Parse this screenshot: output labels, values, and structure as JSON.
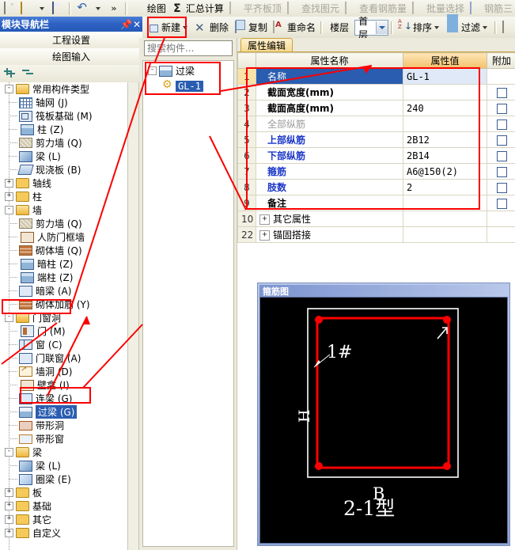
{
  "toolbar_top": {
    "items": [
      {
        "label": "",
        "icon": "new-document-icon",
        "dim": false
      },
      {
        "label": "",
        "icon": "open-folder-icon",
        "dim": false
      },
      {
        "label": "",
        "icon": "dropdown-caret-icon",
        "dim": false
      },
      {
        "label": "",
        "icon": "save-icon",
        "dim": false
      },
      {
        "label": "",
        "icon": "undo-icon",
        "dim": false
      },
      {
        "label": "",
        "icon": "dropdown-caret-icon",
        "dim": false
      },
      {
        "label": "",
        "icon": "more-chevron-icon",
        "dim": false
      },
      {
        "label": "绘图",
        "icon": "draw-pen-icon",
        "dim": false
      },
      {
        "label": "汇总计算",
        "icon": "sigma-icon",
        "dim": false
      },
      {
        "label": "平齐板顶",
        "icon": "align-slab-icon",
        "dim": true
      },
      {
        "label": "查找图元",
        "icon": "find-element-icon",
        "dim": true
      },
      {
        "label": "查看钢筋量",
        "icon": "view-rebar-icon",
        "dim": true
      },
      {
        "label": "批量选择",
        "icon": "batch-select-icon",
        "dim": true
      },
      {
        "label": "钢筋三",
        "icon": "rebar-3d-icon",
        "dim": true
      }
    ]
  },
  "toolbar_second": {
    "new_label": "新建",
    "delete_label": "删除",
    "copy_label": "复制",
    "rename_label": "重命名",
    "floor_label": "楼层",
    "floor_value": "首层",
    "sort_label": "排序",
    "filter_label": "过滤"
  },
  "navigator": {
    "title": "模块导航栏",
    "pin_icon": "pin-icon",
    "close_icon": "close-icon",
    "buttons": [
      "工程设置",
      "绘图输入"
    ],
    "tools": {
      "expand_all": "expand-all-icon",
      "collapse_all": "collapse-all-icon"
    },
    "tree": [
      {
        "level": 0,
        "expander": "-",
        "icon": "folder-open-icon",
        "label": "常用构件类型",
        "selected": false
      },
      {
        "level": 1,
        "expander": "",
        "icon": "axis-grid-icon",
        "label": "轴网 (J)",
        "selected": false
      },
      {
        "level": 1,
        "expander": "",
        "icon": "raft-foundation-icon",
        "label": "筏板基础 (M)",
        "selected": false
      },
      {
        "level": 1,
        "expander": "",
        "icon": "column-icon",
        "label": "柱 (Z)",
        "selected": false
      },
      {
        "level": 1,
        "expander": "",
        "icon": "shear-wall-icon",
        "label": "剪力墙 (Q)",
        "selected": false
      },
      {
        "level": 1,
        "expander": "",
        "icon": "beam-icon",
        "label": "梁 (L)",
        "selected": false
      },
      {
        "level": 1,
        "expander": "",
        "icon": "slab-icon",
        "label": "现浇板 (B)",
        "selected": false
      },
      {
        "level": 0,
        "expander": "+",
        "icon": "folder-icon",
        "label": "轴线",
        "selected": false
      },
      {
        "level": 0,
        "expander": "+",
        "icon": "folder-icon",
        "label": "柱",
        "selected": false
      },
      {
        "level": 0,
        "expander": "-",
        "icon": "folder-open-icon",
        "label": "墙",
        "selected": false
      },
      {
        "level": 1,
        "expander": "",
        "icon": "shear-wall-icon",
        "label": "剪力墙 (Q)",
        "selected": false
      },
      {
        "level": 1,
        "expander": "",
        "icon": "air-defense-door-frame-wall-icon",
        "label": "人防门框墙",
        "selected": false
      },
      {
        "level": 1,
        "expander": "",
        "icon": "masonry-wall-icon",
        "label": "砌体墙 (Q)",
        "selected": false
      },
      {
        "level": 1,
        "expander": "",
        "icon": "hidden-column-icon",
        "label": "暗柱 (Z)",
        "selected": false
      },
      {
        "level": 1,
        "expander": "",
        "icon": "end-column-icon",
        "label": "端柱 (Z)",
        "selected": false
      },
      {
        "level": 1,
        "expander": "",
        "icon": "hidden-beam-icon",
        "label": "暗梁 (A)",
        "selected": false
      },
      {
        "level": 1,
        "expander": "",
        "icon": "masonry-reinforcement-icon",
        "label": "砌体加筋 (Y)",
        "selected": false
      },
      {
        "level": 0,
        "expander": "-",
        "icon": "folder-open-icon",
        "label": "门窗洞",
        "selected": false
      },
      {
        "level": 1,
        "expander": "",
        "icon": "door-icon",
        "label": "门 (M)",
        "selected": false
      },
      {
        "level": 1,
        "expander": "",
        "icon": "window-icon",
        "label": "窗 (C)",
        "selected": false
      },
      {
        "level": 1,
        "expander": "",
        "icon": "door-window-icon",
        "label": "门联窗 (A)",
        "selected": false
      },
      {
        "level": 1,
        "expander": "",
        "icon": "wall-opening-icon",
        "label": "墙洞 (D)",
        "selected": false
      },
      {
        "level": 1,
        "expander": "",
        "icon": "niche-icon",
        "label": "壁龛 (I)",
        "selected": false
      },
      {
        "level": 1,
        "expander": "",
        "icon": "coupling-beam-icon",
        "label": "连梁 (G)",
        "selected": false
      },
      {
        "level": 1,
        "expander": "",
        "icon": "lintel-icon",
        "label": "过梁 (G)",
        "selected": true
      },
      {
        "level": 1,
        "expander": "",
        "icon": "strip-opening-icon",
        "label": "带形洞",
        "selected": false
      },
      {
        "level": 1,
        "expander": "",
        "icon": "strip-window-icon",
        "label": "带形窗",
        "selected": false
      },
      {
        "level": 0,
        "expander": "-",
        "icon": "folder-open-icon",
        "label": "梁",
        "selected": false
      },
      {
        "level": 1,
        "expander": "",
        "icon": "beam-icon",
        "label": "梁 (L)",
        "selected": false
      },
      {
        "level": 1,
        "expander": "",
        "icon": "ring-beam-icon",
        "label": "圈梁 (E)",
        "selected": false
      },
      {
        "level": 0,
        "expander": "+",
        "icon": "folder-icon",
        "label": "板",
        "selected": false
      },
      {
        "level": 0,
        "expander": "+",
        "icon": "folder-icon",
        "label": "基础",
        "selected": false
      },
      {
        "level": 0,
        "expander": "+",
        "icon": "folder-icon",
        "label": "其它",
        "selected": false
      },
      {
        "level": 0,
        "expander": "+",
        "icon": "folder-icon",
        "label": "自定义",
        "selected": false
      }
    ]
  },
  "component_panel": {
    "search_placeholder": "搜索构件...",
    "search_value": "",
    "search_icon": "search-icon",
    "tree": [
      {
        "level": 0,
        "expander": "-",
        "icon": "lintel-icon",
        "label": "过梁",
        "selected": false
      },
      {
        "level": 1,
        "expander": "",
        "icon": "gear-icon",
        "label": "GL-1",
        "selected": true
      }
    ]
  },
  "property_editor": {
    "tab_label": "属性编辑",
    "columns": [
      "",
      "属性名称",
      "属性值",
      "附加"
    ],
    "rows": [
      {
        "num": "1",
        "name": "名称",
        "value": "GL-1",
        "style": "selected",
        "checkbox": false,
        "expandable": false
      },
      {
        "num": "2",
        "name": "截面宽度(mm)",
        "value": "",
        "style": "normal",
        "checkbox": true,
        "expandable": false
      },
      {
        "num": "3",
        "name": "截面高度(mm)",
        "value": "240",
        "style": "normal",
        "checkbox": true,
        "expandable": false
      },
      {
        "num": "4",
        "name": "全部纵筋",
        "value": "",
        "style": "disabled",
        "checkbox": true,
        "expandable": false
      },
      {
        "num": "5",
        "name": "上部纵筋",
        "value": "2B12",
        "style": "blue",
        "checkbox": true,
        "expandable": false
      },
      {
        "num": "6",
        "name": "下部纵筋",
        "value": "2B14",
        "style": "blue",
        "checkbox": true,
        "expandable": false
      },
      {
        "num": "7",
        "name": "箍筋",
        "value": "A6@150(2)",
        "style": "blue",
        "checkbox": true,
        "expandable": false
      },
      {
        "num": "8",
        "name": "肢数",
        "value": "2",
        "style": "blue",
        "checkbox": true,
        "expandable": false
      },
      {
        "num": "9",
        "name": "备注",
        "value": "",
        "style": "normal",
        "checkbox": true,
        "expandable": false
      },
      {
        "num": "10",
        "name": "其它属性",
        "value": "",
        "style": "normal",
        "checkbox": false,
        "expandable": true
      },
      {
        "num": "22",
        "name": "锚固搭接",
        "value": "",
        "style": "normal",
        "checkbox": false,
        "expandable": true
      }
    ]
  },
  "rebar_diagram": {
    "title": "箍筋图",
    "label_top": "1#",
    "label_left": "H",
    "label_bottom_b": "B",
    "label_caption": "2-1型",
    "stirrup_color": "#ff0000",
    "outline_color": "#ffffff",
    "background_color": "#000000"
  },
  "annotations": {
    "color": "#fb0000",
    "boxes": [
      {
        "name": "new-button-highlight"
      },
      {
        "name": "component-tree-highlight"
      },
      {
        "name": "property-rows-highlight"
      },
      {
        "name": "door-window-folder-highlight"
      },
      {
        "name": "lintel-node-highlight"
      }
    ]
  }
}
